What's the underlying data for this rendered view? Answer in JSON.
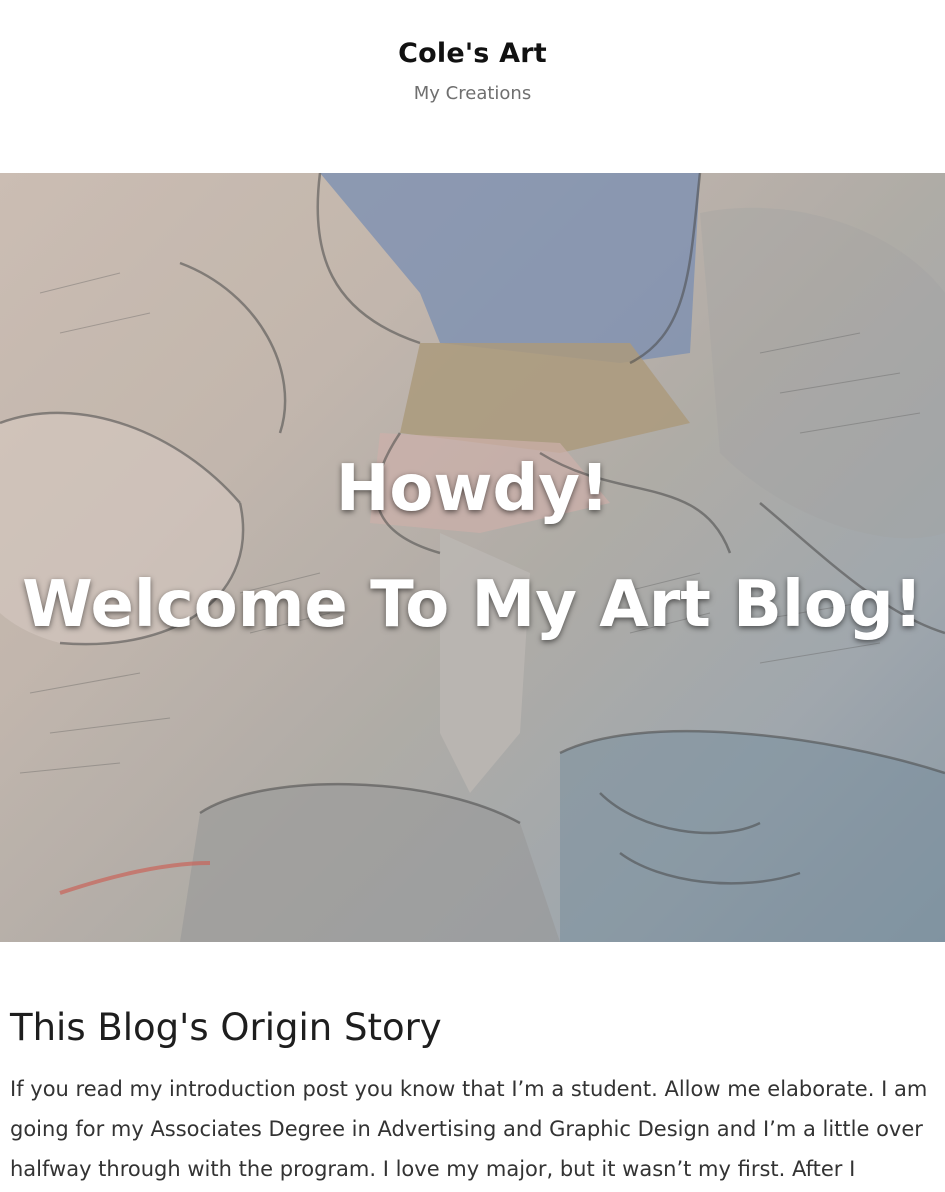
{
  "site": {
    "title": "Cole's Art",
    "tagline": "My Creations"
  },
  "hero": {
    "line1": "Howdy!",
    "line2": "Welcome To My Art Blog!"
  },
  "post": {
    "title": "This Blog's Origin Story",
    "body": "If you read my introduction post you know that I’m a student. Allow me elaborate. I am going for my Associates Degree in Advertising and Graphic Design and I’m a little over halfway through with the program. I love my major, but it wasn’t my first. After I"
  }
}
